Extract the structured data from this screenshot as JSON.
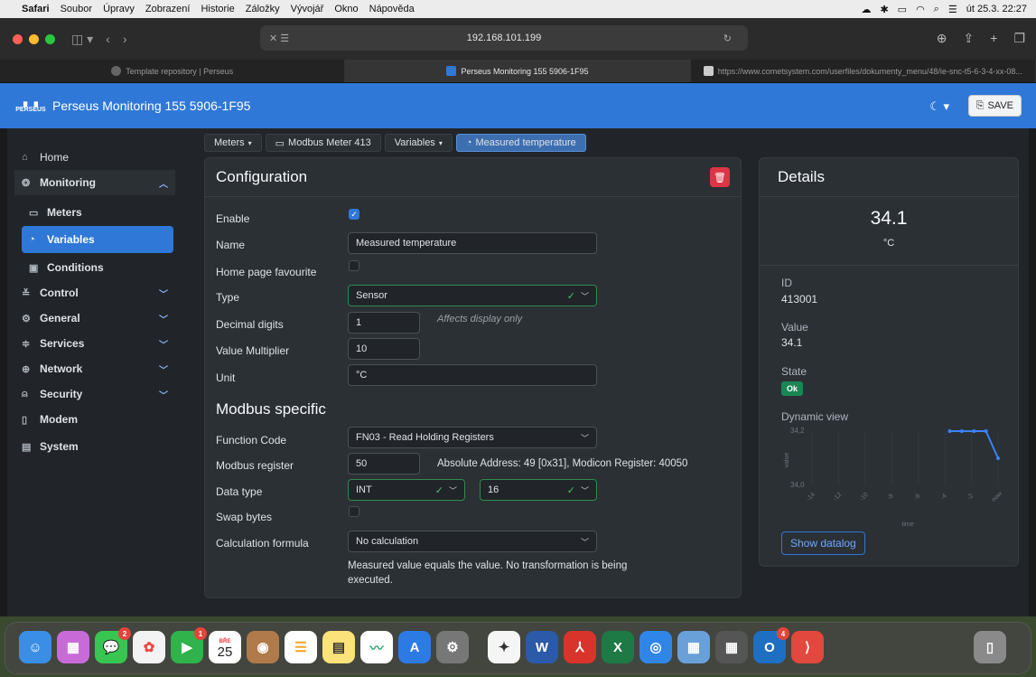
{
  "menubar": {
    "app": "Safari",
    "items": [
      "Soubor",
      "Úpravy",
      "Zobrazení",
      "Historie",
      "Záložky",
      "Vývojář",
      "Okno",
      "Nápověda"
    ],
    "datetime": "út 25.3.  22:27"
  },
  "browser": {
    "url": "192.168.101.199",
    "tabs": [
      {
        "label": "Template repository | Perseus",
        "active": false
      },
      {
        "label": "Perseus Monitoring 155 5906-1F95",
        "active": true
      },
      {
        "label": "https://www.cometsystem.com/userfiles/dokumenty_menu/48/ie-snc-t5-6-3-4-xx-08...",
        "active": false
      }
    ]
  },
  "app": {
    "logo_text": "PERSEUS",
    "title": "Perseus Monitoring 155 5906-1F95",
    "save_label": "SAVE"
  },
  "sidebar": {
    "items": [
      {
        "label": "Home",
        "icon": "home-icon"
      },
      {
        "label": "Monitoring",
        "icon": "monitoring-icon"
      },
      {
        "label": "Meters",
        "icon": "meter-icon"
      },
      {
        "label": "Variables",
        "icon": "gauge-icon"
      },
      {
        "label": "Conditions",
        "icon": "clipboard-icon"
      },
      {
        "label": "Control",
        "icon": "sliders-icon"
      },
      {
        "label": "General",
        "icon": "gear-icon"
      },
      {
        "label": "Services",
        "icon": "services-icon"
      },
      {
        "label": "Network",
        "icon": "globe-icon"
      },
      {
        "label": "Security",
        "icon": "lock-icon"
      },
      {
        "label": "Modem",
        "icon": "modem-icon"
      },
      {
        "label": "System",
        "icon": "system-icon"
      }
    ]
  },
  "breadcrumbs": [
    "Meters",
    "Modbus Meter 413",
    "Variables",
    "Measured temperature"
  ],
  "config": {
    "title": "Configuration",
    "enable_label": "Enable",
    "enable_checked": true,
    "name_label": "Name",
    "name_value": "Measured temperature",
    "favourite_label": "Home page favourite",
    "favourite_checked": false,
    "type_label": "Type",
    "type_value": "Sensor",
    "decimal_label": "Decimal digits",
    "decimal_value": "1",
    "decimal_hint": "Affects display only",
    "multiplier_label": "Value Multiplier",
    "multiplier_value": "10",
    "unit_label": "Unit",
    "unit_value": "°C"
  },
  "modbus": {
    "title": "Modbus specific",
    "function_label": "Function Code",
    "function_value": "FN03 - Read Holding Registers",
    "register_label": "Modbus register",
    "register_value": "50",
    "register_info": "Absolute Address: 49 [0x31], Modicon Register: 40050",
    "datatype_label": "Data type",
    "datatype_value": "INT",
    "datatype_bits": "16",
    "swap_label": "Swap bytes",
    "swap_checked": false,
    "formula_label": "Calculation formula",
    "formula_value": "No calculation",
    "formula_desc": "Measured value equals the value. No transformation is being executed."
  },
  "details": {
    "title": "Details",
    "value_big": "34.1",
    "unit": "°C",
    "id_label": "ID",
    "id_value": "413001",
    "value_label": "Value",
    "value_value": "34.1",
    "state_label": "State",
    "state_value": "Ok",
    "dynamic_label": "Dynamic view",
    "show_datalog": "Show datalog",
    "chart": {
      "y_ticks": [
        "34,2",
        "34,0"
      ],
      "ylabel": "value",
      "xlabel": "time",
      "x_ticks": [
        "-14",
        "-12",
        "-10",
        "-8",
        "-6",
        "-4",
        "-2",
        "now"
      ]
    }
  },
  "chart_data": {
    "type": "line",
    "x": [
      "-4",
      "-3",
      "-2",
      "-1",
      "now"
    ],
    "values": [
      34.2,
      34.2,
      34.2,
      34.2,
      34.1
    ],
    "xlabel": "time",
    "ylabel": "value",
    "ylim": [
      34.0,
      34.2
    ]
  },
  "dock": {
    "badges": {
      "messages": "2",
      "facetime": "1",
      "calendar_month": "BŘE",
      "calendar_day": "25",
      "outlook": "4"
    }
  }
}
